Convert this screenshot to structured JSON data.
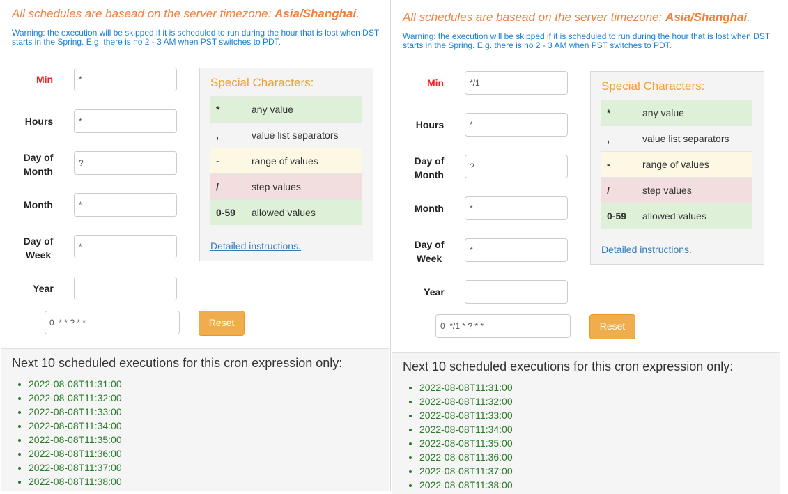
{
  "timezone_note": {
    "prefix": "All schedules are basead on the server timezone: ",
    "tz": "Asia/Shanghai",
    "suffix": "."
  },
  "warning": "Warning: the execution will be skipped if it is scheduled to run during the hour that is lost when DST starts in the Spring. E.g. there is no 2 - 3 AM when PST switches to PDT.",
  "labels": {
    "min": "Min",
    "hours": "Hours",
    "dom_1": "Day of",
    "dom_2": "Month",
    "month": "Month",
    "dow_1": "Day of",
    "dow_2": "Week",
    "year": "Year"
  },
  "special": {
    "title": "Special Characters:",
    "rows": [
      {
        "sym": "*",
        "desc": "any value",
        "color": "#dff0d8"
      },
      {
        "sym": ",",
        "desc": "value list separators",
        "color": "#f4f4f4"
      },
      {
        "sym": "-",
        "desc": "range of values",
        "color": "#fcf8e3"
      },
      {
        "sym": "/",
        "desc": "step values",
        "color": "#f2dede"
      },
      {
        "sym": "0-59",
        "desc": "allowed values",
        "color": "#dff0d8"
      }
    ],
    "link": "Detailed instructions."
  },
  "reset_label": "Reset",
  "next_title": "Next 10 scheduled executions for this cron expression only:",
  "left": {
    "fields": {
      "min": "*",
      "hours": "*",
      "dom": "?",
      "month": "*",
      "dow": "*",
      "year": ""
    },
    "expression": "0  * * ? * *",
    "executions": [
      "2022-08-08T11:31:00",
      "2022-08-08T11:32:00",
      "2022-08-08T11:33:00",
      "2022-08-08T11:34:00",
      "2022-08-08T11:35:00",
      "2022-08-08T11:36:00",
      "2022-08-08T11:37:00",
      "2022-08-08T11:38:00"
    ]
  },
  "right": {
    "fields": {
      "min": "*/1",
      "hours": "*",
      "dom": "?",
      "month": "*",
      "dow": "*",
      "year": ""
    },
    "expression": "0  */1 * ? * *",
    "executions": [
      "2022-08-08T11:31:00",
      "2022-08-08T11:32:00",
      "2022-08-08T11:33:00",
      "2022-08-08T11:34:00",
      "2022-08-08T11:35:00",
      "2022-08-08T11:36:00",
      "2022-08-08T11:37:00",
      "2022-08-08T11:38:00"
    ]
  }
}
